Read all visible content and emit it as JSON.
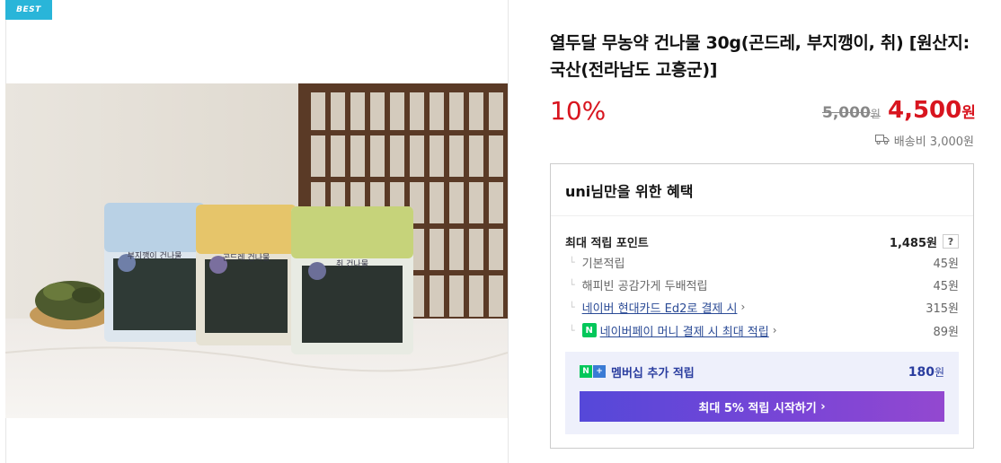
{
  "badge": "BEST",
  "product": {
    "title": "열두달 무농약 건나물 30g(곤드레, 부지깽이, 취) [원산지:국산(전라남도 고흥군)]",
    "discount": "10%",
    "original_price": "5,000",
    "original_unit": "원",
    "sale_price": "4,500",
    "sale_unit": "원",
    "shipping": "배송비 3,000원"
  },
  "package_labels": [
    "부지깽이 건나물",
    "곤드레 건나물",
    "취 건나물"
  ],
  "benefits": {
    "title": "uni님만을 위한 혜택",
    "max_points_label": "최대 적립 포인트",
    "max_points_value": "1,485원",
    "help": "?",
    "items": [
      {
        "label": "기본적립",
        "value": "45원"
      },
      {
        "label": "해피빈 공감가게 두배적립",
        "value": "45원"
      },
      {
        "label": "네이버 현대카드 Ed2로 결제 시",
        "value": "315원"
      },
      {
        "label": "네이버페이 머니 결제 시 최대 적립",
        "value": "89원"
      }
    ],
    "membership_label": "멤버십 추가 적립",
    "membership_value": "180",
    "membership_unit": "원",
    "cta_label": "최대 5% 적립 시작하기"
  },
  "icons": {
    "truck": "truck-icon",
    "npay": "npay-icon",
    "chevron": "chevron-right-icon"
  },
  "colors": {
    "badge": "#29b5d9",
    "price_red": "#d8151f",
    "naver_green": "#03c75a",
    "membership_blue": "#2a3d9f",
    "cta_start": "#5548d9",
    "cta_end": "#9348d0"
  }
}
